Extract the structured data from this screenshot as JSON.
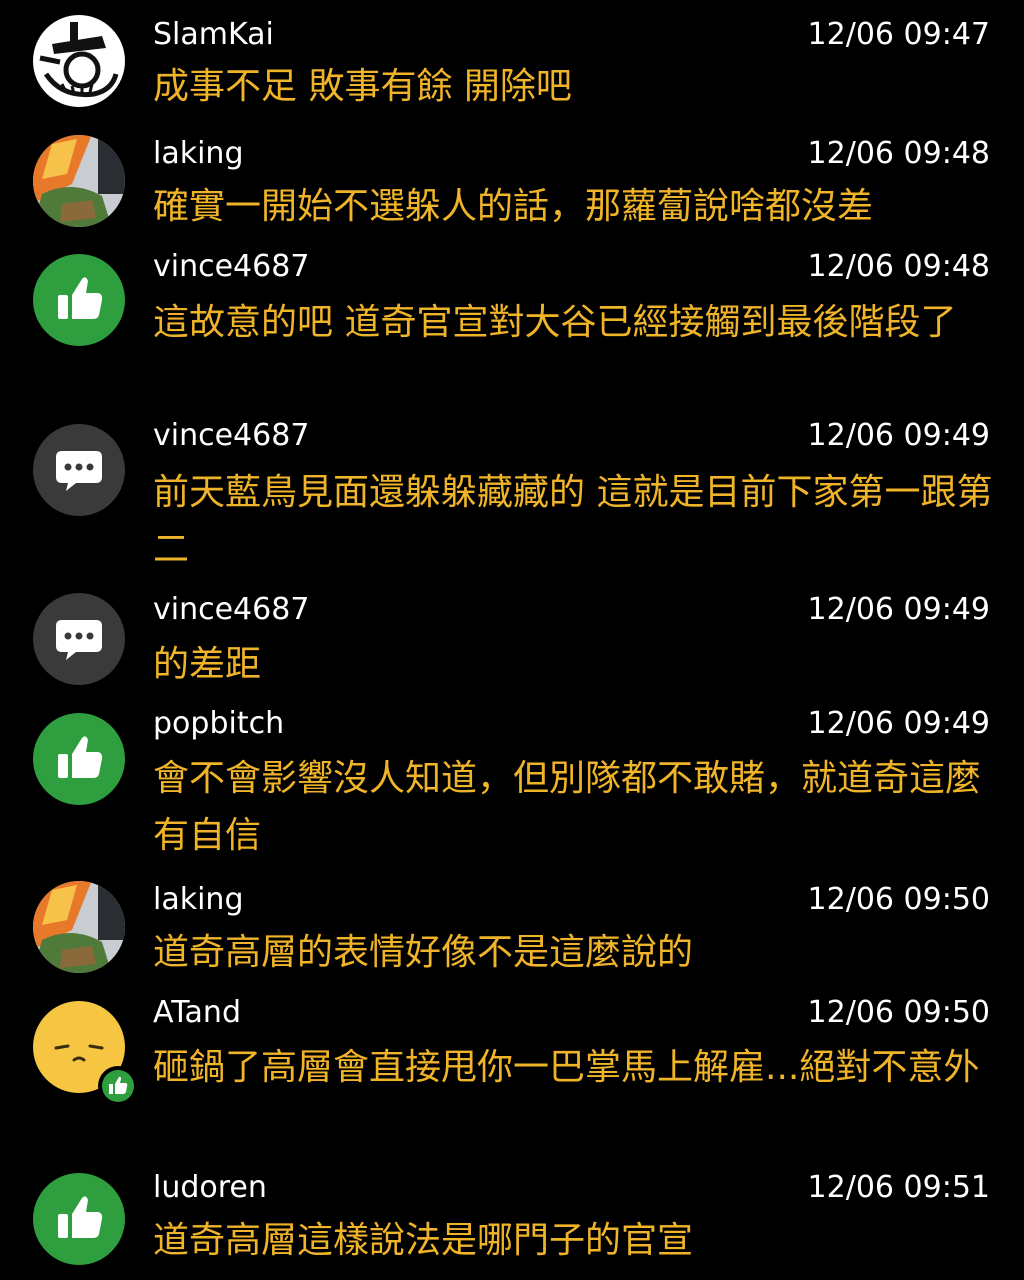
{
  "colors": {
    "background": "#000000",
    "username": "#ffffff",
    "timestamp": "#ffffff",
    "message": "#f0b429",
    "like_green": "#2e9e3e",
    "bubble_gray": "#3a3a3a"
  },
  "comments": [
    {
      "user": "SlamKai",
      "time": "12/06 09:47",
      "text": "成事不足 敗事有餘 開除吧",
      "avatar": "cartoon-avatar-icon"
    },
    {
      "user": "laking",
      "time": "12/06 09:48",
      "text": "確實一開始不選躲人的話，那蘿蔔說啥都沒差",
      "avatar": "photo-avatar-icon"
    },
    {
      "user": "vince4687",
      "time": "12/06 09:48",
      "text": "這故意的吧 道奇官宣對大谷已經接觸到最後階段了",
      "avatar": "thumbs-up-icon"
    },
    {
      "user": "vince4687",
      "time": "12/06 09:49",
      "text": "前天藍鳥見面還躲躲藏藏的 這就是目前下家第一跟第二",
      "avatar": "chat-bubble-icon"
    },
    {
      "user": "vince4687",
      "time": "12/06 09:49",
      "text": "的差距",
      "avatar": "chat-bubble-icon"
    },
    {
      "user": "popbitch",
      "time": "12/06 09:49",
      "text": "會不會影響沒人知道，但別隊都不敢賭，就道奇這麼有自信",
      "avatar": "thumbs-up-icon"
    },
    {
      "user": "laking",
      "time": "12/06 09:50",
      "text": "道奇高層的表情好像不是這麼說的",
      "avatar": "photo-avatar-icon"
    },
    {
      "user": "ATand",
      "time": "12/06 09:50",
      "text": "砸鍋了高層會直接甩你一巴掌馬上解雇...絕對不意外",
      "avatar": "egg-face-icon"
    },
    {
      "user": "ludoren",
      "time": "12/06 09:51",
      "text": "道奇高層這樣說法是哪門子的官宣",
      "avatar": "thumbs-up-icon"
    }
  ]
}
